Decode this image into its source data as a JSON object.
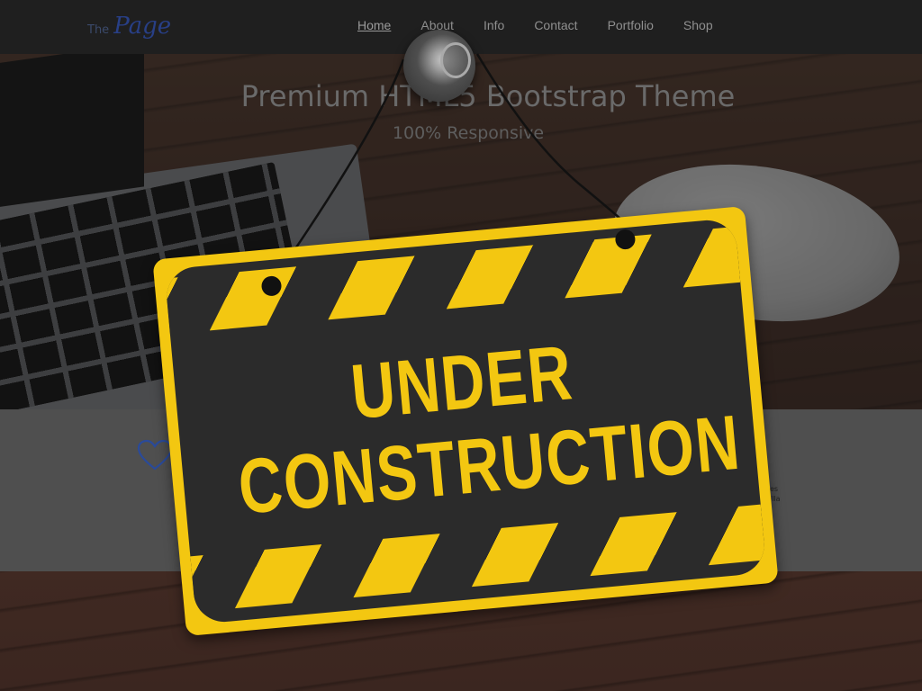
{
  "brand": {
    "prefix": "The",
    "name": "Page"
  },
  "nav": {
    "items": [
      {
        "label": "Home",
        "active": true
      },
      {
        "label": "About",
        "active": false
      },
      {
        "label": "Info",
        "active": false
      },
      {
        "label": "Contact",
        "active": false
      },
      {
        "label": "Portfolio",
        "active": false
      },
      {
        "label": "Shop",
        "active": false
      }
    ]
  },
  "hero": {
    "title": "Premium HTML5 Bootstrap Theme",
    "subtitle": "100% Responsive"
  },
  "features": {
    "icon": "heart-icon",
    "fragment_lines": [
      "es",
      "illa"
    ]
  },
  "sign": {
    "line1": "UNDER",
    "line2": "CONSTRUCTION",
    "colors": {
      "yellow": "#f3c711",
      "dark": "#2b2b2b"
    }
  }
}
